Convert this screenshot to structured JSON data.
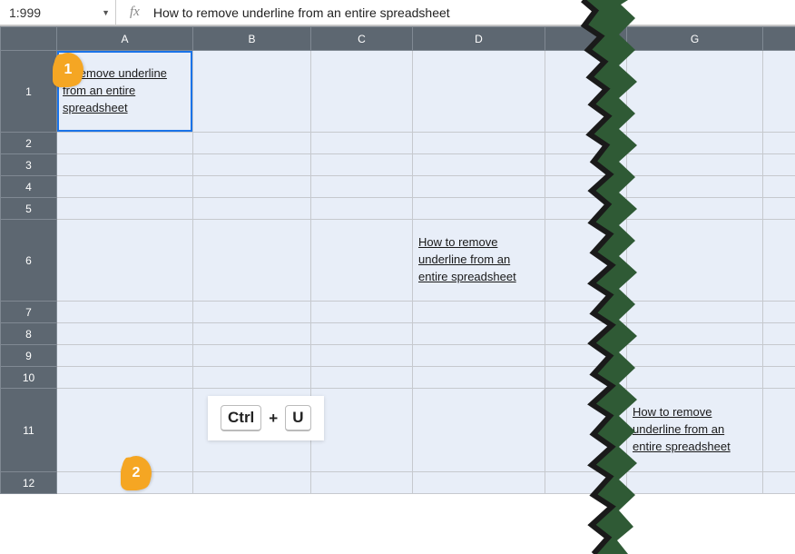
{
  "formula_bar": {
    "name_box": "1:999",
    "fx_label": "fx",
    "formula_value": "How to remove underline from an entire spreadsheet"
  },
  "columns": [
    "A",
    "B",
    "C",
    "D",
    "",
    "",
    "G",
    ""
  ],
  "rows": [
    {
      "num": "1",
      "tall": true
    },
    {
      "num": "2"
    },
    {
      "num": "3"
    },
    {
      "num": "4"
    },
    {
      "num": "5"
    },
    {
      "num": "6",
      "tall": true
    },
    {
      "num": "7"
    },
    {
      "num": "8"
    },
    {
      "num": "9"
    },
    {
      "num": "10"
    },
    {
      "num": "11",
      "tall": true
    },
    {
      "num": "12"
    }
  ],
  "cells": {
    "A1": "to remove underline from an entire spreadsheet",
    "D6": "How to remove underline from an entire spreadsheet",
    "G11": "How to remove underline from an entire spreadsheet"
  },
  "callouts": {
    "badge1": "1",
    "badge2": "2"
  },
  "shortcut": {
    "key1": "Ctrl",
    "plus": "+",
    "key2": "U"
  }
}
